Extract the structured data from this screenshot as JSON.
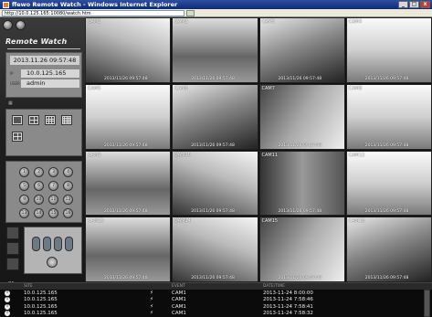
{
  "window": {
    "title": "ffewo Remote Watch - Windows Internet Explorer",
    "url": "http://10.0.125.165:10080/watch.htm",
    "controls": [
      "_",
      "□",
      "x"
    ]
  },
  "sidebar": {
    "brand": "Remote Watch",
    "info": {
      "section_icon": "user-icon",
      "date_time": "2013.11.26 09:57:48",
      "ip_label": "IP",
      "ip": "10.0.125.165",
      "user_label": "USER",
      "user": "admin"
    },
    "layout_label": "LAYOUT",
    "camera_buttons": [
      "1",
      "2",
      "3",
      "4",
      "5",
      "6",
      "7",
      "8",
      "9",
      "10",
      "11",
      "12",
      "13",
      "14",
      "15",
      "16"
    ],
    "footer_icons": [
      "network-icon",
      "folder-icon"
    ]
  },
  "cameras": [
    {
      "name": "CAM1",
      "time": "2013/11/26 09:57:48"
    },
    {
      "name": "CAM2",
      "time": "2013/11/26 09:57:48"
    },
    {
      "name": "CAM3",
      "time": "2013/11/26 09:57:48"
    },
    {
      "name": "CAM4",
      "time": "2013/11/26 09:57:48"
    },
    {
      "name": "CAM5",
      "time": "2013/11/26 09:57:48"
    },
    {
      "name": "CAM6",
      "time": "2013/11/26 09:57:48"
    },
    {
      "name": "CAM7",
      "time": "2013/11/26 09:57:48"
    },
    {
      "name": "CAM8",
      "time": "2013/11/26 09:57:48"
    },
    {
      "name": "CAM9",
      "time": "2013/11/26 09:57:48"
    },
    {
      "name": "CAM10",
      "time": "2013/11/26 09:57:48"
    },
    {
      "name": "CAM11",
      "time": "2013/11/26 09:57:48"
    },
    {
      "name": "CAM12",
      "time": "2013/11/26 09:57:48"
    },
    {
      "name": "CAM13",
      "time": "2013/11/26 09:57:48"
    },
    {
      "name": "CAM14",
      "time": "2013/11/26 09:57:48"
    },
    {
      "name": "CAM15",
      "time": "2013/11/26 09:57:48"
    },
    {
      "name": "CAM16",
      "time": "2013/11/26 09:57:48"
    }
  ],
  "events": {
    "headers": {
      "site": "SITE",
      "event": "EVENT",
      "date": "DATE/TIME"
    },
    "rows": [
      {
        "site": "10.0.125.165",
        "event": "CAM1",
        "date": "2013-11-24 8:00:00"
      },
      {
        "site": "10.0.125.165",
        "event": "CAM1",
        "date": "2013-11-24 7:58:46"
      },
      {
        "site": "10.0.125.165",
        "event": "CAM1",
        "date": "2013-11-24 7:58:41"
      },
      {
        "site": "10.0.125.165",
        "event": "CAM1",
        "date": "2013-11-24 7:58:32"
      }
    ]
  }
}
